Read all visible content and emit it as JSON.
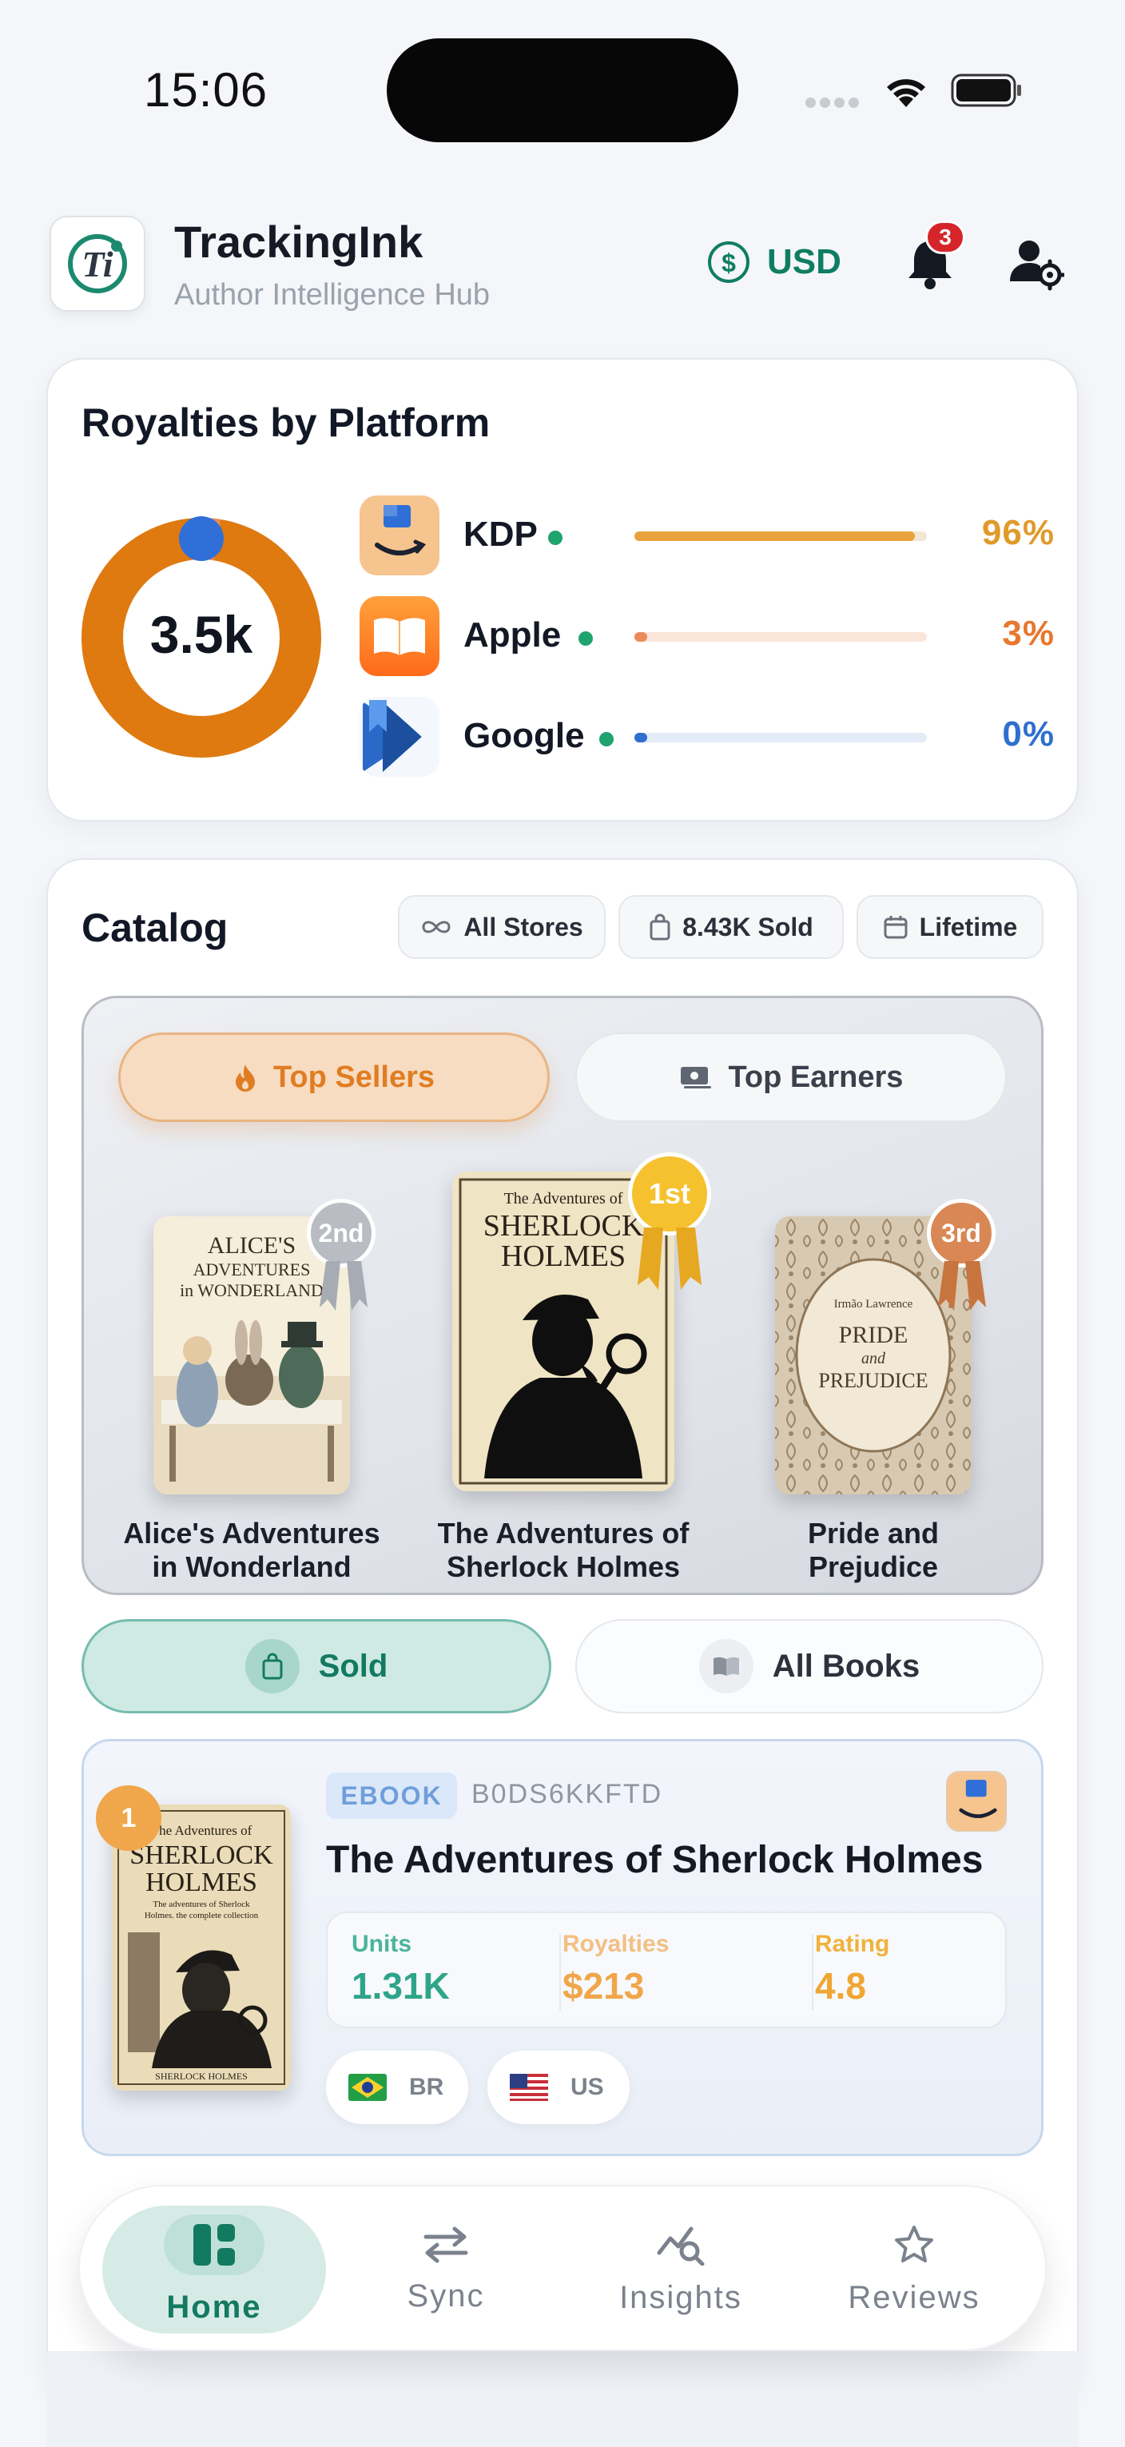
{
  "status_bar": {
    "time": "15:06"
  },
  "header": {
    "app_title": "TrackingInk",
    "app_subtitle": "Author Intelligence Hub",
    "currency": "USD",
    "notification_count": "3"
  },
  "royalties": {
    "title": "Royalties by Platform",
    "total": "3.5k",
    "platforms": [
      {
        "name": "KDP",
        "percent": "96%",
        "share": 0.96,
        "color": "#e8a33d"
      },
      {
        "name": "Apple",
        "percent": "3%",
        "share": 0.03,
        "color": "#ec8a5c"
      },
      {
        "name": "Google",
        "percent": "0%",
        "share": 0.0,
        "color": "#2f6fcf"
      }
    ]
  },
  "catalog": {
    "title": "Catalog",
    "chips": [
      "All Stores",
      "8.43K Sold",
      "Lifetime"
    ],
    "toggle": {
      "top_sellers": "Top Sellers",
      "top_earners": "Top Earners"
    },
    "podium": [
      {
        "rank": "2nd",
        "title_line1": "Alice's Adventures",
        "title_line2": "in Wonderland",
        "cover_text": [
          "ALICE'S",
          "ADVENTURES",
          "in WONDERLAND"
        ]
      },
      {
        "rank": "1st",
        "title_line1": "The Adventures of",
        "title_line2": "Sherlock Holmes",
        "cover_text": [
          "The Adventures of",
          "SHERLOCK",
          "HOLMES"
        ]
      },
      {
        "rank": "3rd",
        "title_line1": "Pride and",
        "title_line2": "Prejudice",
        "cover_text": [
          "Irmão Lawrence",
          "PRIDE",
          "and",
          "PREJUDICE"
        ]
      }
    ],
    "segments": {
      "sold": "Sold",
      "all_books": "All Books"
    },
    "listing": {
      "rank": "1",
      "format": "EBOOK",
      "asin": "B0DS6KKFTD",
      "title": "The Adventures of Sherlock Holmes",
      "cover_text": [
        "The Adventures of",
        "SHERLOCK",
        "HOLMES",
        "The adventures of Sherlock",
        "Holmes. the complete collection",
        "SHERLOCK HOLMES"
      ],
      "stats": [
        {
          "label": "Units",
          "value": "1.31K",
          "color": "#2ea58a"
        },
        {
          "label": "Royalties",
          "value": "$213",
          "color": "#f0a64a"
        },
        {
          "label": "Rating",
          "value": "4.8",
          "color": "#f0a633"
        }
      ],
      "markets": [
        "BR",
        "US"
      ]
    }
  },
  "nav": {
    "items": [
      "Home",
      "Sync",
      "Insights",
      "Reviews"
    ]
  }
}
